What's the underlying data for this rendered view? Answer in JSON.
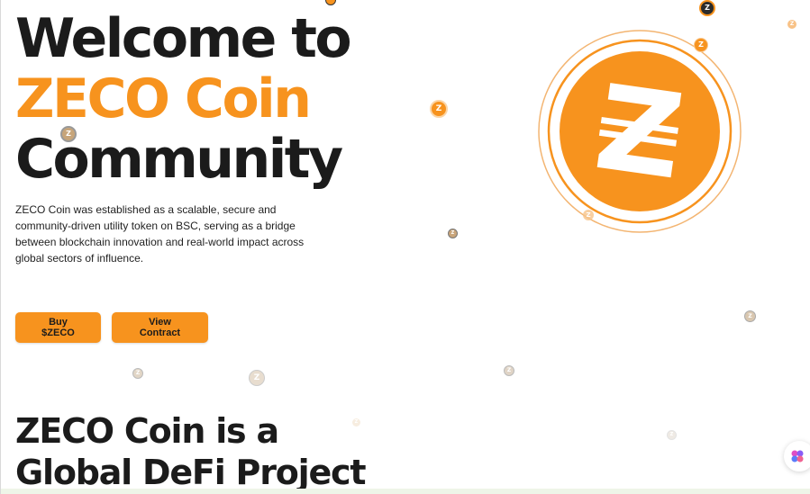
{
  "hero": {
    "title_line1": "Welcome to",
    "title_line2": "ZECO Coin",
    "title_line3": "Community",
    "description": "ZECO Coin was established as a scalable, secure and community-driven utility token on BSC, serving as a bridge between blockchain innovation and real-world impact across global sectors of influence."
  },
  "buttons": {
    "buy_label": "Buy $ZECO",
    "contract_label": "View Contract"
  },
  "section": {
    "title_line1": "ZECO Coin is a",
    "title_line2": "Global DeFi Project"
  },
  "coin": {
    "glyph": "Z"
  },
  "icons": {
    "hero_coin": "zeco-coin-logo-icon",
    "floating_coin": "zeco-coin-icon",
    "chat_widget": "chat-widget-icon"
  },
  "colors": {
    "accent": "#f7931e",
    "text": "#1b1b1b",
    "background": "#ffffff"
  }
}
